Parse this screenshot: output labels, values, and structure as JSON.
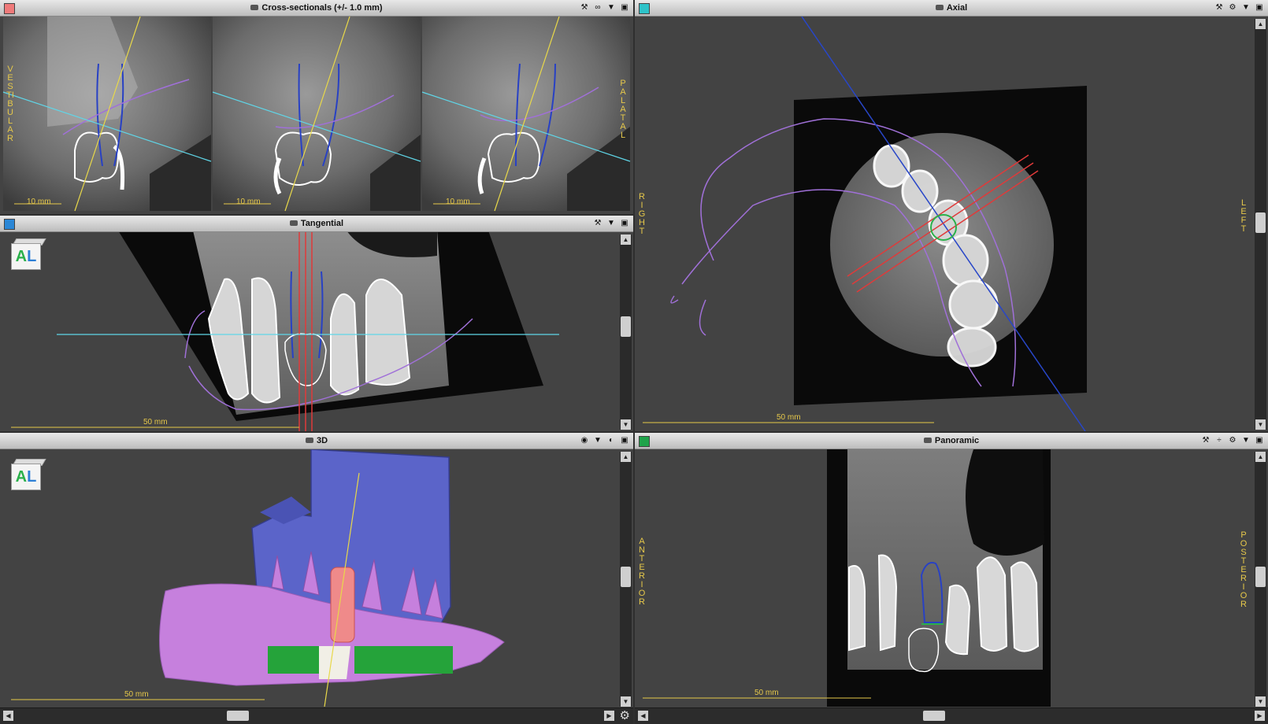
{
  "panels": {
    "cross": {
      "title": "Cross-sectionals (+/- 1.0 mm)",
      "swatch": "#ef7a7a",
      "left_label": "VESTIBULAR",
      "right_label": "PALATAL",
      "scales": [
        "10 mm",
        "10 mm",
        "10 mm"
      ]
    },
    "axial": {
      "title": "Axial",
      "swatch": "#2ec3c9",
      "left_label": "RIGHT",
      "right_label": "LEFT",
      "scale": "50 mm"
    },
    "tangential": {
      "title": "Tangential",
      "swatch": "#2b87d6",
      "scale": "50 mm",
      "cube": {
        "a": "A",
        "l": "L"
      }
    },
    "three_d": {
      "title": "3D",
      "scale": "50 mm",
      "cube": {
        "a": "A",
        "l": "L"
      }
    },
    "panoramic": {
      "title": "Panoramic",
      "swatch": "#1fa34a",
      "left_label": "ANTERIOR",
      "right_label": "POSTERIOR",
      "scale": "50 mm"
    }
  },
  "icons": [
    "camera-icon",
    "tools-icon",
    "link-icon",
    "dropdown-arrow-icon",
    "maximize-icon",
    "eye-icon",
    "settings-gear-icon",
    "scroll-up-icon",
    "scroll-down-icon",
    "scroll-left-icon",
    "scroll-right-icon"
  ]
}
